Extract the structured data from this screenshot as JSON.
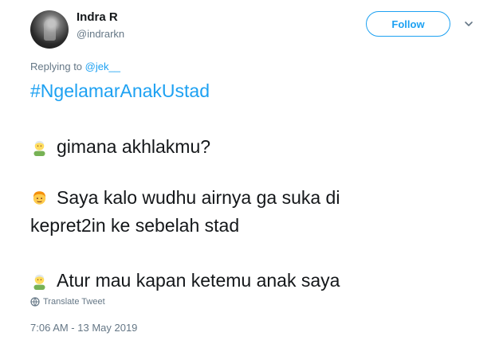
{
  "author": {
    "display_name": "Indra R",
    "screen_name": "@indrarkn"
  },
  "follow_button": {
    "label": "Follow"
  },
  "reply_context": {
    "prefix": "Replying to ",
    "mention": "@jek__"
  },
  "tweet": {
    "hashtag": "#NgelamarAnakUstad",
    "lines": [
      "gimana akhlakmu?",
      "Saya kalo wudhu airnya ga suka di",
      "kepret2in ke sebelah stad",
      "Atur mau kapan ketemu anak saya"
    ],
    "emojis": [
      "older-man-emoji",
      "boy-emoji",
      "older-man-emoji"
    ]
  },
  "translate": {
    "label": "Translate Tweet"
  },
  "timestamp": "7:06 AM - 13 May 2019",
  "colors": {
    "accent": "#1da1f2",
    "text": "#14171a",
    "muted": "#657786"
  }
}
